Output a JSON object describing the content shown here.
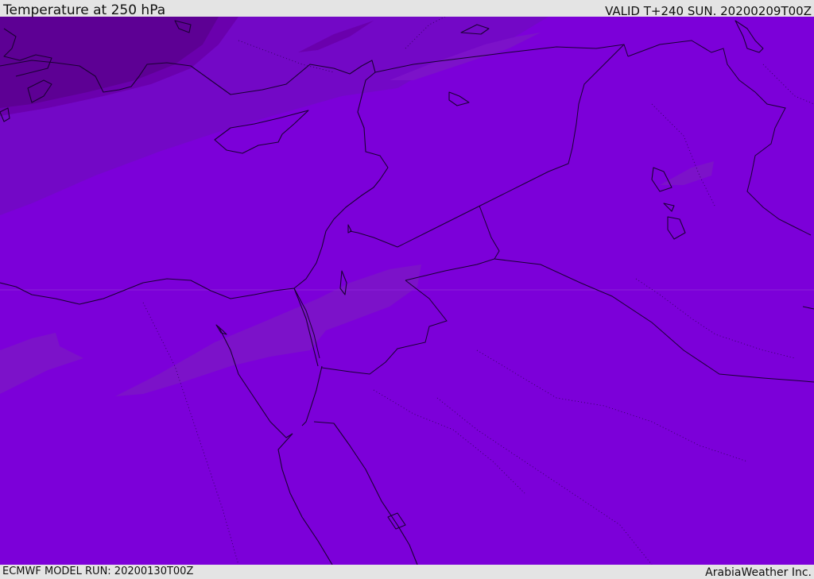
{
  "header": {
    "title": "Temperature at 250 hPa",
    "valid_time": "VALID T+240 SUN. 20200209T00Z"
  },
  "footer": {
    "model_run": "ECMWF MODEL RUN: 20200130T00Z",
    "credit": "ArabiaWeather Inc."
  },
  "map": {
    "colors": {
      "background_fill": "#7c00d9",
      "band_darkest": "#5d0094",
      "band_dark": "#6a00ad",
      "band_mid": "#7308c6",
      "band_light": "#7c12c9",
      "coastline": "#1a0033"
    }
  }
}
